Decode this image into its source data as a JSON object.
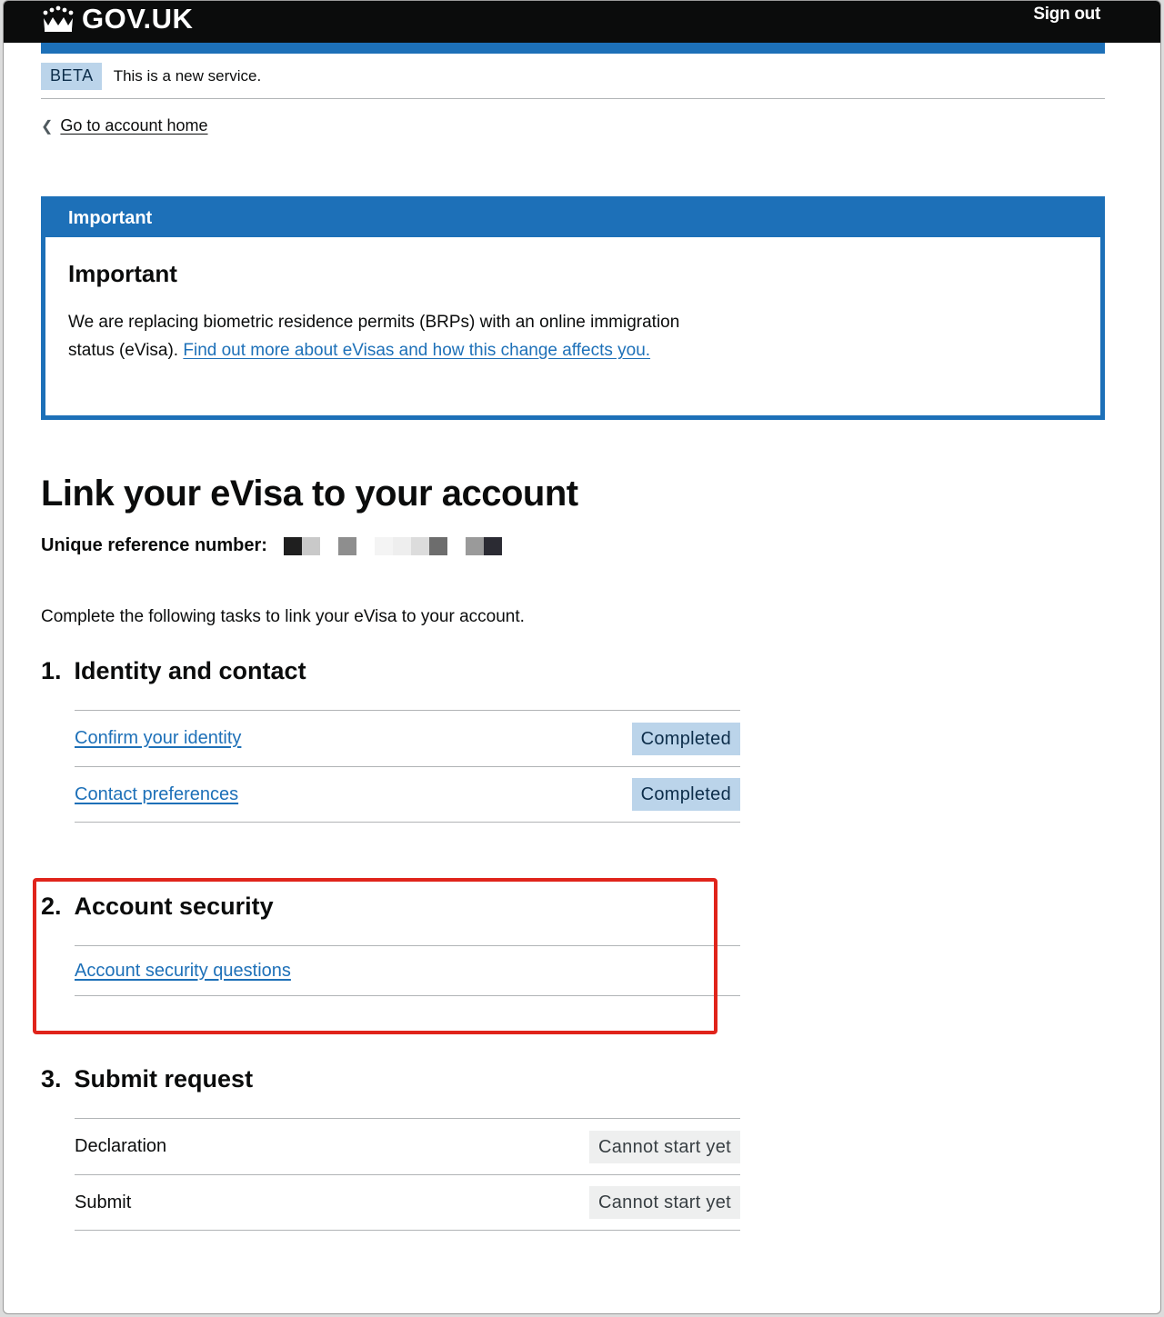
{
  "header": {
    "logo_text": "GOV.UK",
    "sign_out": "Sign out"
  },
  "phase": {
    "tag": "BETA",
    "text": "This is a new service."
  },
  "back_link": "Go to account home",
  "notice": {
    "title": "Important",
    "heading": "Important",
    "text": "We are replacing biometric residence permits (BRPs) with an online immigration status (eVisa). ",
    "link": "Find out more about eVisas and how this change affects you."
  },
  "page": {
    "title": "Link your eVisa to your account",
    "ref_label": "Unique reference number:",
    "intro": "Complete the following tasks to link your eVisa to your account."
  },
  "sections": [
    {
      "number": "1.",
      "title": "Identity and contact",
      "tasks": [
        {
          "name": "Confirm your identity",
          "status": "Completed"
        },
        {
          "name": "Contact preferences",
          "status": "Completed"
        }
      ]
    },
    {
      "number": "2.",
      "title": "Account security",
      "tasks": [
        {
          "name": "Account security questions",
          "status": ""
        }
      ]
    },
    {
      "number": "3.",
      "title": "Submit request",
      "tasks": [
        {
          "name": "Declaration",
          "status": "Cannot start yet"
        },
        {
          "name": "Submit",
          "status": "Cannot start yet"
        }
      ]
    }
  ],
  "colors": {
    "brand_blue": "#1d70b8",
    "header_black": "#0b0c0c",
    "tag_blue_bg": "#bbd4ea",
    "tag_grey_bg": "#eeefef",
    "highlight_red": "#e0241b"
  }
}
